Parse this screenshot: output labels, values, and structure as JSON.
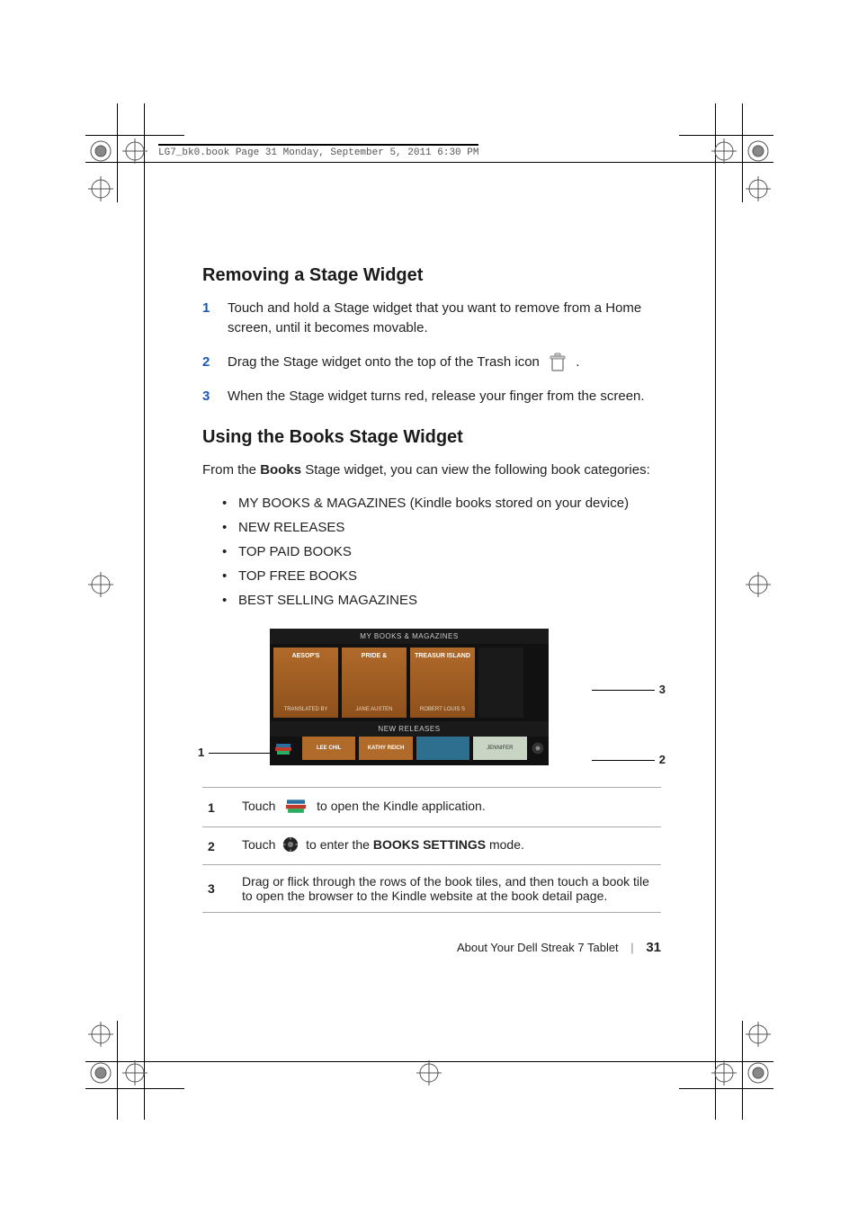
{
  "meta_header": "LG7_bk0.book  Page 31  Monday, September 5, 2011  6:30 PM",
  "section1": {
    "heading": "Removing a Stage Widget",
    "steps": [
      {
        "n": "1",
        "text": "Touch and hold a Stage widget that you want to remove from a Home screen, until it becomes movable."
      },
      {
        "n": "2",
        "text_before": "Drag the Stage widget onto the top of the Trash icon ",
        "text_after": " ."
      },
      {
        "n": "3",
        "text": "When the Stage widget turns red, release your finger from the screen."
      }
    ]
  },
  "section2": {
    "heading": "Using the Books Stage Widget",
    "intro_pre": "From the ",
    "intro_bold": "Books",
    "intro_post": " Stage widget, you can view the following book categories:",
    "bullets": [
      "MY BOOKS & MAGAZINES (Kindle books stored on your device)",
      "NEW RELEASES",
      "TOP PAID BOOKS",
      "TOP FREE BOOKS",
      "BEST SELLING MAGAZINES"
    ]
  },
  "widget": {
    "cat1": "MY BOOKS & MAGAZINES",
    "tiles": [
      {
        "title": "AESOP'S",
        "author": "TRANSLATED BY"
      },
      {
        "title": "PRIDE &",
        "author": "JANE AUSTEN"
      },
      {
        "title": "TREASUR ISLAND",
        "author": "ROBERT LOUIS S"
      }
    ],
    "cat2": "NEW RELEASES",
    "minis": [
      "LEE CHIL",
      "KATHY REICH",
      "",
      "JENNIFER"
    ]
  },
  "callouts": {
    "left": "1",
    "right_top": "3",
    "right_bottom": "2"
  },
  "callout_table": [
    {
      "n": "1",
      "pre": "Touch ",
      "post": " to open the Kindle application.",
      "icon": "kindle"
    },
    {
      "n": "2",
      "pre": "Touch ",
      "mid": " to enter the ",
      "bold": "BOOKS SETTINGS",
      "post": " mode.",
      "icon": "gear"
    },
    {
      "n": "3",
      "text": "Drag or flick through the rows of the book tiles, and then touch a book tile to open the browser to the Kindle website at the book detail page."
    }
  ],
  "footer": {
    "label": "About Your Dell Streak 7 Tablet",
    "page": "31"
  }
}
